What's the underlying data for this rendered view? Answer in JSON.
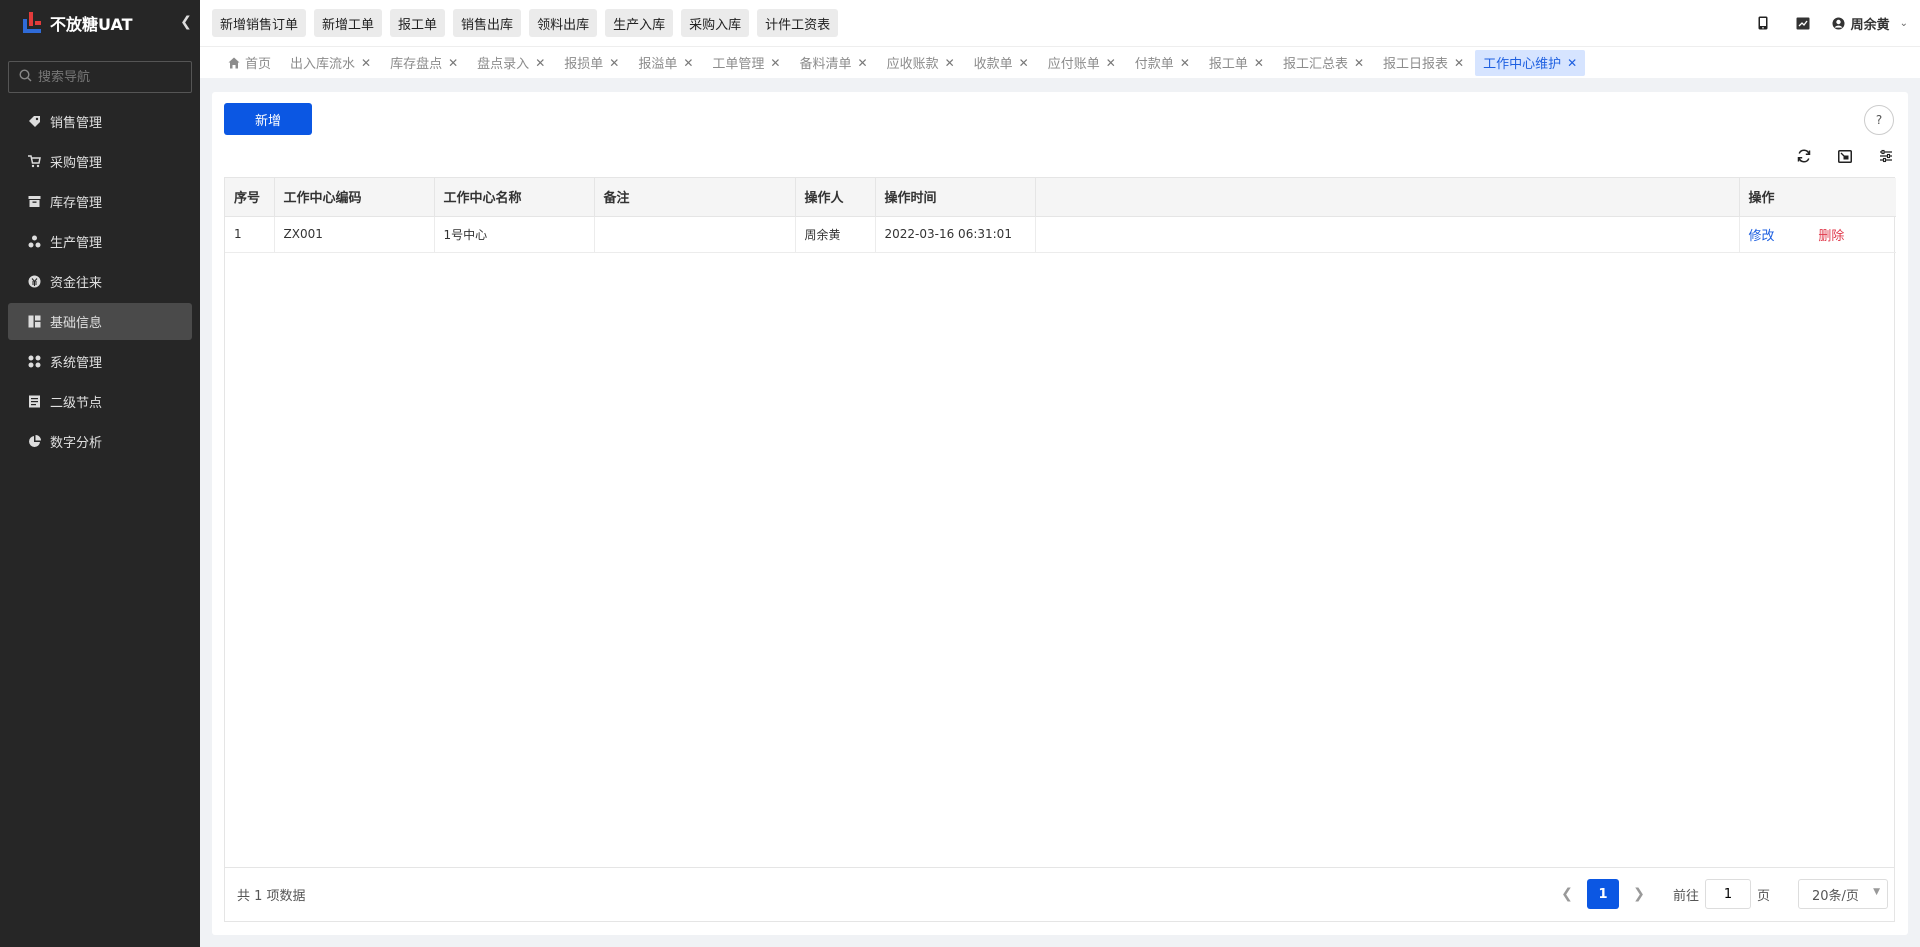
{
  "app": {
    "title": "不放糖UAT"
  },
  "sidebar": {
    "search_placeholder": "搜索导航",
    "items": [
      {
        "label": "销售管理",
        "icon": "tag-icon"
      },
      {
        "label": "采购管理",
        "icon": "cart-icon"
      },
      {
        "label": "库存管理",
        "icon": "box-icon"
      },
      {
        "label": "生产管理",
        "icon": "cluster-icon"
      },
      {
        "label": "资金往来",
        "icon": "money-icon"
      },
      {
        "label": "基础信息",
        "icon": "layout-icon",
        "active": true
      },
      {
        "label": "系统管理",
        "icon": "apps-icon"
      },
      {
        "label": "二级节点",
        "icon": "doc-icon"
      },
      {
        "label": "数字分析",
        "icon": "pie-icon"
      }
    ]
  },
  "topbar": {
    "quick_buttons": [
      "新增销售订单",
      "新增工单",
      "报工单",
      "销售出库",
      "领料出库",
      "生产入库",
      "采购入库",
      "计件工资表"
    ],
    "user_name": "周余黄"
  },
  "tabs": [
    {
      "label": "首页",
      "closable": false
    },
    {
      "label": "出入库流水"
    },
    {
      "label": "库存盘点"
    },
    {
      "label": "盘点录入"
    },
    {
      "label": "报损单"
    },
    {
      "label": "报溢单"
    },
    {
      "label": "工单管理"
    },
    {
      "label": "备料清单"
    },
    {
      "label": "应收账款"
    },
    {
      "label": "收款单"
    },
    {
      "label": "应付账单"
    },
    {
      "label": "付款单"
    },
    {
      "label": "报工单"
    },
    {
      "label": "报工汇总表"
    },
    {
      "label": "报工日报表"
    },
    {
      "label": "工作中心维护",
      "active": true
    }
  ],
  "main": {
    "add_label": "新增",
    "help_label": "?",
    "table": {
      "columns": [
        "序号",
        "工作中心编码",
        "工作中心名称",
        "备注",
        "操作人",
        "操作时间",
        "",
        "操作"
      ],
      "rows": [
        {
          "index": "1",
          "code": "ZX001",
          "name": "1号中心",
          "remark": "",
          "operator": "周余黄",
          "time": "2022-03-16 06:31:01",
          "edit": "修改",
          "delete": "删除"
        }
      ]
    },
    "pagination": {
      "total_text": "共 1 项数据",
      "current_page": "1",
      "goto_prefix": "前往",
      "goto_value": "1",
      "goto_suffix": "页",
      "page_size": "20条/页"
    }
  },
  "colors": {
    "primary": "#0b57e3",
    "sidebar_bg": "#262626",
    "danger": "#e0384a"
  }
}
